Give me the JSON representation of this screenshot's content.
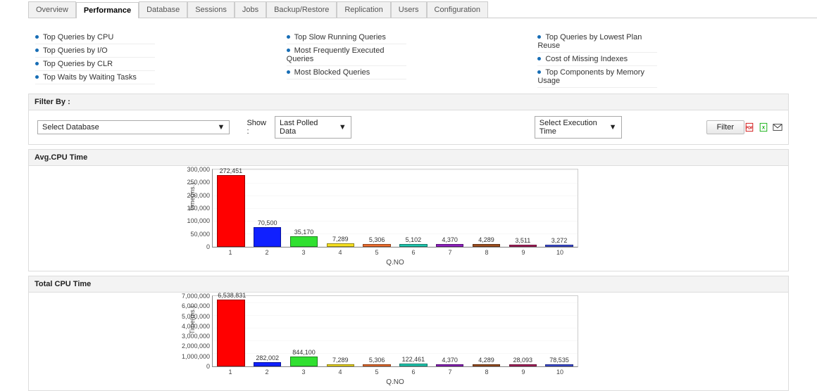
{
  "tabs": [
    "Overview",
    "Performance",
    "Database",
    "Sessions",
    "Jobs",
    "Backup/Restore",
    "Replication",
    "Users",
    "Configuration"
  ],
  "active_tab": 1,
  "link_cols": [
    [
      "Top Queries by CPU",
      "Top Queries by I/O",
      "Top Queries by CLR",
      "Top Waits by Waiting Tasks"
    ],
    [
      "Top Slow Running Queries",
      "Most Frequently Executed Queries",
      "Most Blocked Queries"
    ],
    [
      "Top Queries by Lowest Plan Reuse",
      "Cost of Missing Indexes",
      "Top Components by Memory Usage"
    ]
  ],
  "filter": {
    "title": "Filter By :",
    "select_db": "Select Database",
    "show_lbl": "Show :",
    "show_val": "Last Polled Data",
    "exec_val": "Select Execution Time",
    "btn": "Filter"
  },
  "export_icons": [
    "pdf-icon",
    "xls-icon",
    "mail-icon"
  ],
  "charts": [
    {
      "title": "Avg.CPU Time",
      "height": 110,
      "xlabel": "Q.NO",
      "ylabel": "Time(ms.)"
    },
    {
      "title": "Total CPU Time",
      "height": 100,
      "xlabel": "Q.NO",
      "ylabel": "Time(ms.)"
    }
  ],
  "chart_data": [
    {
      "type": "bar",
      "title": "Avg.CPU Time",
      "xlabel": "Q.NO",
      "ylabel": "Time(ms.)",
      "categories": [
        "1",
        "2",
        "3",
        "4",
        "5",
        "6",
        "7",
        "8",
        "9",
        "10"
      ],
      "values": [
        272451,
        70500,
        35170,
        7289,
        5306,
        5102,
        4370,
        4289,
        3511,
        3272
      ],
      "value_labels": [
        "272,451",
        "70,500",
        "35,170",
        "7,289",
        "5,306",
        "5,102",
        "4,370",
        "4,289",
        "3,511",
        "3,272"
      ],
      "colors": [
        "#ff0000",
        "#1020ff",
        "#30e030",
        "#f6e020",
        "#f07030",
        "#20c8b0",
        "#9020c0",
        "#a05020",
        "#b02060",
        "#4050e0"
      ],
      "ylim": [
        0,
        300000
      ],
      "yticks": [
        0,
        50000,
        100000,
        150000,
        200000,
        250000,
        300000
      ],
      "ytick_labels": [
        "0",
        "50,000",
        "100,000",
        "150,000",
        "200,000",
        "250,000",
        "300,000"
      ]
    },
    {
      "type": "bar",
      "title": "Total CPU Time",
      "xlabel": "Q.NO",
      "ylabel": "Time(ms.)",
      "categories": [
        "1",
        "2",
        "3",
        "4",
        "5",
        "6",
        "7",
        "8",
        "9",
        "10"
      ],
      "values": [
        6538831,
        282002,
        844100,
        7289,
        5306,
        122461,
        4370,
        4289,
        28093,
        78535
      ],
      "value_labels": [
        "6,538,831",
        "282,002",
        "844,100",
        "7,289",
        "5,306",
        "122,461",
        "4,370",
        "4,289",
        "28,093",
        "78,535"
      ],
      "colors": [
        "#ff0000",
        "#1020ff",
        "#30e030",
        "#f6e020",
        "#f07030",
        "#20c8b0",
        "#9020c0",
        "#a05020",
        "#b02060",
        "#4050e0"
      ],
      "ylim": [
        0,
        7000000
      ],
      "yticks": [
        0,
        1000000,
        2000000,
        3000000,
        4000000,
        5000000,
        6000000,
        7000000
      ],
      "ytick_labels": [
        "0",
        "1,000,000",
        "2,000,000",
        "3,000,000",
        "4,000,000",
        "5,000,000",
        "6,000,000",
        "7,000,000"
      ]
    }
  ]
}
